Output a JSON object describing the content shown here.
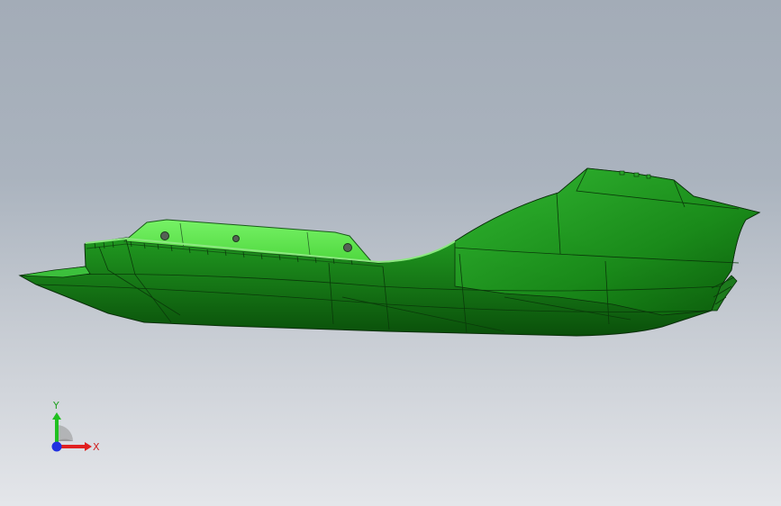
{
  "viewport": {
    "background_top": "#a3acb7",
    "background_bottom": "#e4e6ea"
  },
  "model": {
    "body_color": "#1f9c1f",
    "body_dark": "#0b5a0b",
    "highlight_color": "#66ee55",
    "edge_color": "#0a2e0a"
  },
  "triad": {
    "x_label": "X",
    "y_label": "Y",
    "x_color": "#e02020",
    "y_color": "#20c020",
    "z_color": "#2030e0"
  }
}
